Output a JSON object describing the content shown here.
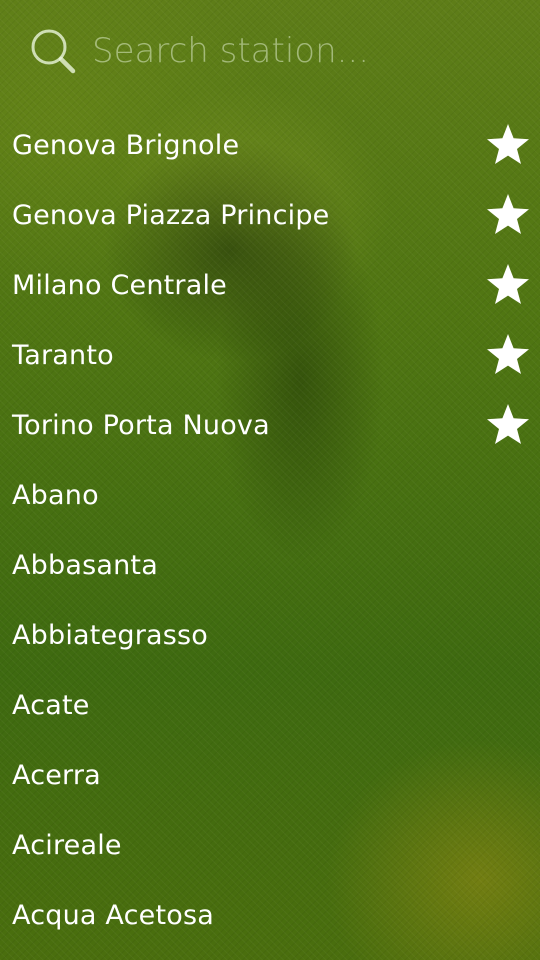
{
  "search": {
    "placeholder": "Search station...",
    "value": ""
  },
  "stations": [
    {
      "name": "Genova Brignole",
      "favorite": true
    },
    {
      "name": "Genova Piazza Principe",
      "favorite": true
    },
    {
      "name": "Milano Centrale",
      "favorite": true
    },
    {
      "name": "Taranto",
      "favorite": true
    },
    {
      "name": "Torino Porta Nuova",
      "favorite": true
    },
    {
      "name": "Abano",
      "favorite": false
    },
    {
      "name": "Abbasanta",
      "favorite": false
    },
    {
      "name": "Abbiategrasso",
      "favorite": false
    },
    {
      "name": "Acate",
      "favorite": false
    },
    {
      "name": "Acerra",
      "favorite": false
    },
    {
      "name": "Acireale",
      "favorite": false
    },
    {
      "name": "Acqua Acetosa",
      "favorite": false
    }
  ],
  "icons": {
    "search": "search-icon",
    "favorite": "star-icon"
  },
  "colors": {
    "text": "#ffffff",
    "placeholder": "#dcebc8"
  }
}
